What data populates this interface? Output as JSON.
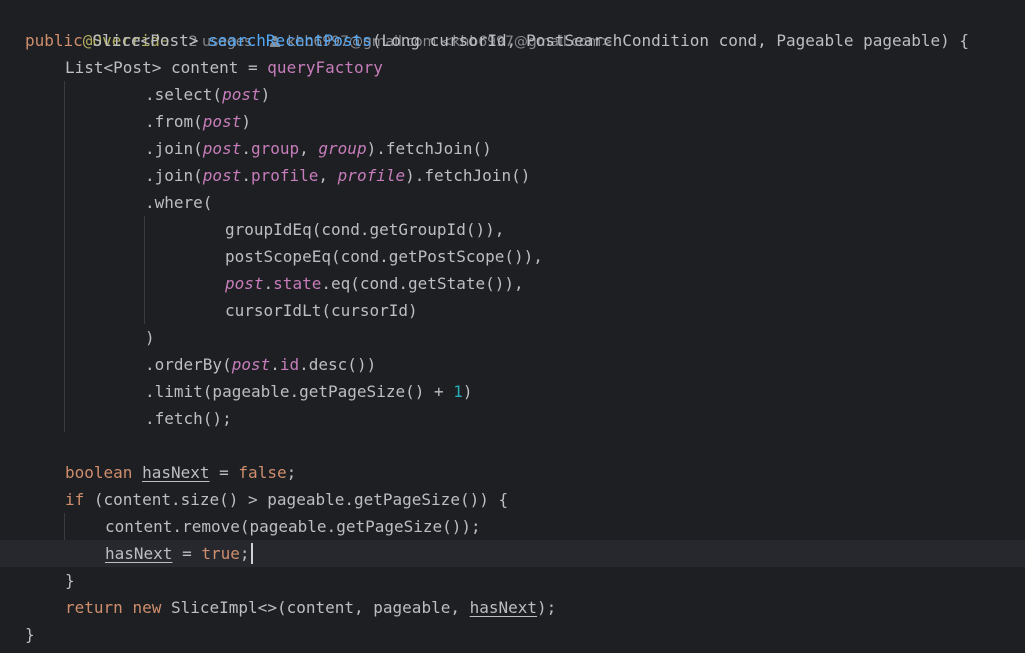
{
  "header": {
    "annotation": "@Override",
    "usages": "2 usages",
    "author": "khb6997@gmail.com <khb6997@gmail.com>"
  },
  "code": {
    "l1_public": "public",
    "l1_slice": "Slice<Post>",
    "l1_method": "searchRecentPosts",
    "l1_params": "(Long cursorId, PostSearchCondition cond, Pageable pageable) {",
    "l2_type": "List<Post> content = ",
    "l2_qf": "queryFactory",
    "l3_a": ".select(",
    "l3_b": "post",
    "l3_c": ")",
    "l4_a": ".from(",
    "l4_b": "post",
    "l4_c": ")",
    "l5_a": ".join(",
    "l5_b": "post",
    "l5_c": ".",
    "l5_d": "group",
    "l5_e": ", ",
    "l5_f": "group",
    "l5_g": ").fetchJoin()",
    "l6_a": ".join(",
    "l6_b": "post",
    "l6_c": ".",
    "l6_d": "profile",
    "l6_e": ", ",
    "l6_f": "profile",
    "l6_g": ").fetchJoin()",
    "l7": ".where(",
    "l8": "groupIdEq(cond.getGroupId()),",
    "l9": "postScopeEq(cond.getPostScope()),",
    "l10_a": "post",
    "l10_b": ".",
    "l10_c": "state",
    "l10_d": ".eq(cond.getState()),",
    "l11": "cursorIdLt(cursorId)",
    "l12": ")",
    "l13_a": ".orderBy(",
    "l13_b": "post",
    "l13_c": ".",
    "l13_d": "id",
    "l13_e": ".desc())",
    "l14_a": ".limit(pageable.getPageSize() + ",
    "l14_b": "1",
    "l14_c": ")",
    "l15": ".fetch();",
    "l17_a": "boolean",
    "l17_b": "hasNext",
    "l17_c": " = ",
    "l17_d": "false",
    "l17_e": ";",
    "l18_a": "if",
    "l18_b": " (content.size() > pageable.getPageSize()) {",
    "l19": "content.remove(pageable.getPageSize());",
    "l20_a": "hasNext",
    "l20_b": " = ",
    "l20_c": "true",
    "l20_d": ";",
    "l21": "}",
    "l22_a": "return",
    "l22_b": "new",
    "l22_c": "SliceImpl<>(content, pageable, ",
    "l22_d": "hasNext",
    "l22_e": ");",
    "l23": "}"
  },
  "colors": {
    "background": "#1e1f22",
    "current_line": "#26282e",
    "keyword": "#cf8e6d",
    "method_decl": "#56a8f5",
    "field": "#c77dbb",
    "number": "#2aacb8",
    "annotation": "#b3ae60",
    "text": "#bcbec4"
  }
}
